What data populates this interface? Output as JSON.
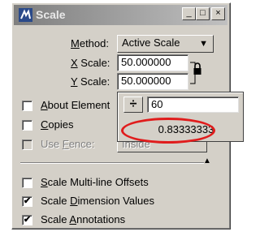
{
  "window": {
    "title": "Scale",
    "controls": {
      "minimize": "_",
      "maximize": "□",
      "close": "×"
    }
  },
  "method": {
    "label_prefix": "",
    "label_key": "M",
    "label_rest": "ethod:",
    "value": "Active Scale"
  },
  "x_scale": {
    "label_key": "X",
    "label_rest": " Scale:",
    "value": "50.000000"
  },
  "y_scale": {
    "label_key": "Y",
    "label_rest": " Scale:",
    "value": "50.000000"
  },
  "about_element": {
    "label_prefix": "",
    "label_key": "A",
    "label_rest": "bout Element",
    "checked": false
  },
  "copies": {
    "label_key": "C",
    "label_rest": "opies",
    "checked": false
  },
  "use_fence": {
    "label_prefix": "Use ",
    "label_key": "F",
    "label_rest": "ence:",
    "value": "Inside",
    "checked": false,
    "enabled": false
  },
  "options": [
    {
      "label_key": "S",
      "label_rest": "cale Multi-line Offsets",
      "checked": false
    },
    {
      "label_prefix": "Scale ",
      "label_key": "D",
      "label_rest": "imension Values",
      "checked": true
    },
    {
      "label_prefix": "Scale ",
      "label_key": "A",
      "label_rest": "nnotations",
      "checked": true
    }
  ],
  "calculator": {
    "operator": "÷",
    "input": "60",
    "result": "0.83333333"
  },
  "icons": [
    "app-icon",
    "lock-icon",
    "expand-arrow-icon",
    "dropdown-arrow-icon",
    "divide-icon"
  ],
  "colors": {
    "highlight_oval": "#e01c1c",
    "dialog_face": "#d4d0c8"
  }
}
